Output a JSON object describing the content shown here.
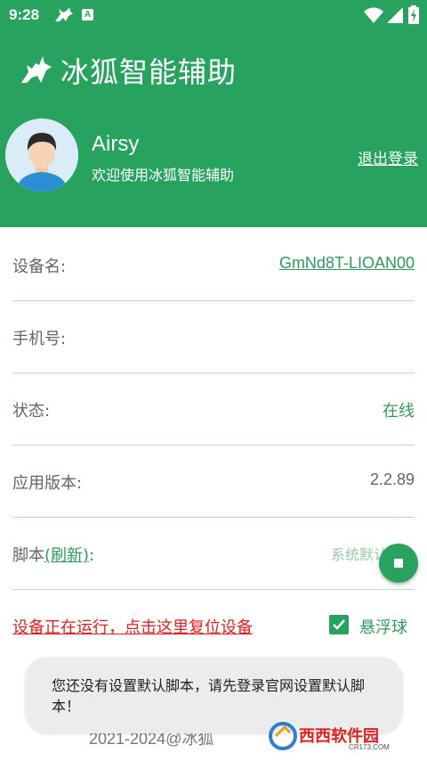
{
  "status_bar": {
    "time": "9:28",
    "icons": [
      "fox-icon",
      "a-notification-icon",
      "wifi-icon",
      "signal-icon",
      "battery-charging-icon"
    ]
  },
  "header": {
    "app_title": "冰狐智能辅助",
    "user_name": "Airsy",
    "welcome": "欢迎使用冰狐智能辅助",
    "logout": "退出登录"
  },
  "info_rows": [
    {
      "label": "设备名:",
      "value": "GmNd8T-LIOAN00"
    },
    {
      "label": "手机号:",
      "value": ""
    },
    {
      "label": "状态:",
      "value": "在线"
    },
    {
      "label": "应用版本:",
      "value": "2.2.89"
    }
  ],
  "script_row": {
    "label": "脚本",
    "refresh": "(刷新)",
    "colon": ":",
    "value": "系统默认脚"
  },
  "reset_link": "设备正在运行，点击这里复位设备",
  "floating_ball": {
    "label": "悬浮球",
    "checked": true
  },
  "toast": "您还没有设置默认脚本，请先登录官网设置默认脚本！",
  "footer": "2021-2024@冰狐",
  "watermark": {
    "brand": "西西软件园",
    "domain": "CR173.COM"
  },
  "colors": {
    "primary": "#28a35f",
    "accent_text": "#2e9a5e",
    "danger": "#e02020",
    "divider": "#b9dcc8"
  }
}
